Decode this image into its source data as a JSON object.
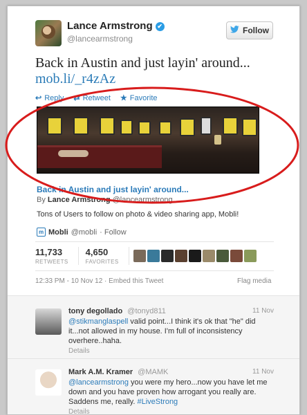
{
  "author": {
    "name": "Lance Armstrong",
    "handle": "@lancearmstrong",
    "verified_glyph": "✔"
  },
  "follow_button": {
    "label": "Follow",
    "icon": "twitter-bird-icon"
  },
  "tweet": {
    "text": "Back in Austin and just layin' around...",
    "link": "mob.li/_r4zAz"
  },
  "actions": {
    "reply": "Reply",
    "retweet": "Retweet",
    "favorite": "Favorite"
  },
  "media": {
    "title": "Back in Austin and just layin' around...",
    "by_prefix": "By",
    "by_name": "Lance Armstrong",
    "by_handle": "@lancearmstrong",
    "description": "Tons of Users to follow on photo & video sharing app, Mobli!",
    "source_name": "Mobli",
    "source_handle": "@mobli",
    "source_follow": "· Follow"
  },
  "stats": {
    "retweets_count": "11,733",
    "retweets_label": "RETWEETS",
    "favorites_count": "4,650",
    "favorites_label": "FAVORITES"
  },
  "meta": {
    "timestamp": "12:33 PM - 10 Nov 12 · Embed this Tweet",
    "flag": "Flag media"
  },
  "replies": [
    {
      "name": "tony degollado",
      "handle": "@tonyd811",
      "date": "11 Nov",
      "mention": "@stikmanglaspell",
      "text": " valid point...I think it's ok that \"he\" did it...not allowed in my house. I'm full of inconsistency overhere..haha.",
      "details": "Details"
    },
    {
      "name": "Mark A.M. Kramer",
      "handle": "@MAMK",
      "date": "11 Nov",
      "mention": "@lancearmstrong",
      "text": " you were my hero...now you have let me down and you have proven how arrogant you really are. Saddens me, really. ",
      "hashtag": "#LiveStrong",
      "details": "Details"
    }
  ],
  "colors": {
    "link": "#2b7bb9",
    "annotation_circle": "#d81c1c",
    "jersey": "#e8d23a"
  }
}
